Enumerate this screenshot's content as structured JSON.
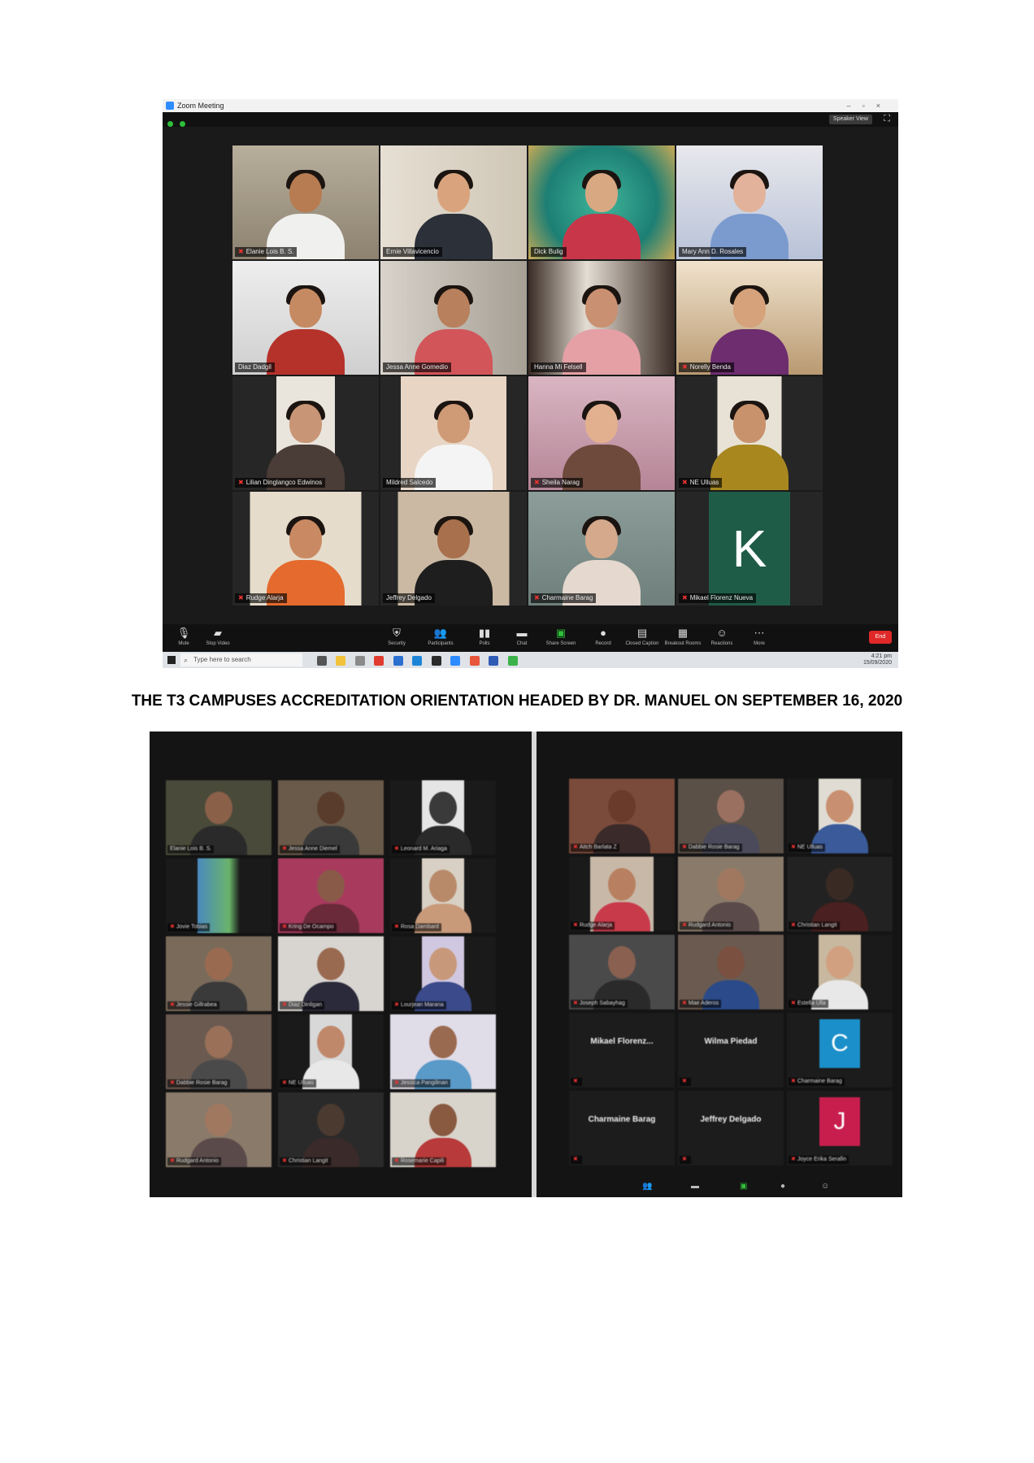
{
  "screenshot1": {
    "window_title": "Zoom Meeting",
    "speaker_view_label": "Speaker View",
    "participants": [
      {
        "name": "Elanie Lois B. S."
      },
      {
        "name": "Ernie Villavicencio"
      },
      {
        "name": "Dick Bulig"
      },
      {
        "name": "Mary Ann D. Rosales"
      },
      {
        "name": "Diaz Dadgil"
      },
      {
        "name": "Jessa Anne Gomedio"
      },
      {
        "name": "Hanna Mi Felsell"
      },
      {
        "name": "Norelly Benda"
      },
      {
        "name": "Lilian Dinglangco Edwinos"
      },
      {
        "name": "Mildred Salcedo"
      },
      {
        "name": "Sheila Narag"
      },
      {
        "name": "NE Ulluas"
      },
      {
        "name": "Rudge Alarja"
      },
      {
        "name": "Jeffrey Delgado"
      },
      {
        "name": "Charmaine Barag"
      },
      {
        "name": "Mikael Florenz Nueva"
      }
    ],
    "letter_avatar": "K",
    "toolbar": [
      {
        "icon": "microphone-icon",
        "label": "Mute"
      },
      {
        "icon": "video-camera-icon",
        "label": "Stop Video"
      },
      {
        "icon": "shield-icon",
        "label": "Security"
      },
      {
        "icon": "participants-icon",
        "label": "Participants"
      },
      {
        "icon": "polls-icon",
        "label": "Polls"
      },
      {
        "icon": "chat-icon",
        "label": "Chat"
      },
      {
        "icon": "share-screen-icon",
        "label": "Share Screen"
      },
      {
        "icon": "record-icon",
        "label": "Record"
      },
      {
        "icon": "closed-caption-icon",
        "label": "Closed Caption"
      },
      {
        "icon": "breakout-rooms-icon",
        "label": "Breakout Rooms"
      },
      {
        "icon": "reactions-icon",
        "label": "Reactions"
      },
      {
        "icon": "more-icon",
        "label": "More"
      }
    ],
    "end_label": "End",
    "taskbar": {
      "search_placeholder": "Type here to search",
      "time": "4:21 pm",
      "date": "15/09/2020"
    }
  },
  "caption": "THE T3 CAMPUSES ACCREDITATION ORIENTATION HEADED BY DR. MANUEL ON SEPTEMBER 16, 2020",
  "screenshot2": {
    "left_participants": [
      {
        "name": "Elanie Lois B. S."
      },
      {
        "name": "Jessa Anne Diemel"
      },
      {
        "name": "Leonard M. Ariaga"
      },
      {
        "name": "Jovie Tobias"
      },
      {
        "name": "Kring De Ocampo"
      },
      {
        "name": "Rosa Dambard"
      },
      {
        "name": "Jessie Gillrabea"
      },
      {
        "name": "Diaz Dinligan"
      },
      {
        "name": "Lourjean Marana"
      },
      {
        "name": "Dabbie Rosie Barag"
      },
      {
        "name": "NE Ulluas"
      },
      {
        "name": "Jessica Pangilinan"
      },
      {
        "name": "Rudgard Antonio"
      },
      {
        "name": "Christian Langit"
      },
      {
        "name": "Rosemarie Capili"
      }
    ],
    "right_participants": [
      {
        "name": "Aitch Barlata Z"
      },
      {
        "name": "Dabbie Rosie Barag"
      },
      {
        "name": "NE Ulluas"
      },
      {
        "name": "Rudge Alarja"
      },
      {
        "name": "Rudgard Antonio"
      },
      {
        "name": "Christian Langit"
      },
      {
        "name": "Joseph Sabayhag"
      },
      {
        "name": "Mae Aderos"
      },
      {
        "name": "Estella Ulla"
      },
      {
        "name": "Charmaine Barag"
      },
      {
        "name": "Joyce Erika Serafin"
      }
    ],
    "no_video_names": [
      "Mikael Florenz...",
      "Wilma Piedad",
      "Charmaine Barag",
      "Jeffrey Delgado"
    ],
    "letter_avatars": [
      {
        "letter": "C",
        "color": "#1b8fc9"
      },
      {
        "letter": "J",
        "color": "#c81e4e"
      }
    ]
  }
}
